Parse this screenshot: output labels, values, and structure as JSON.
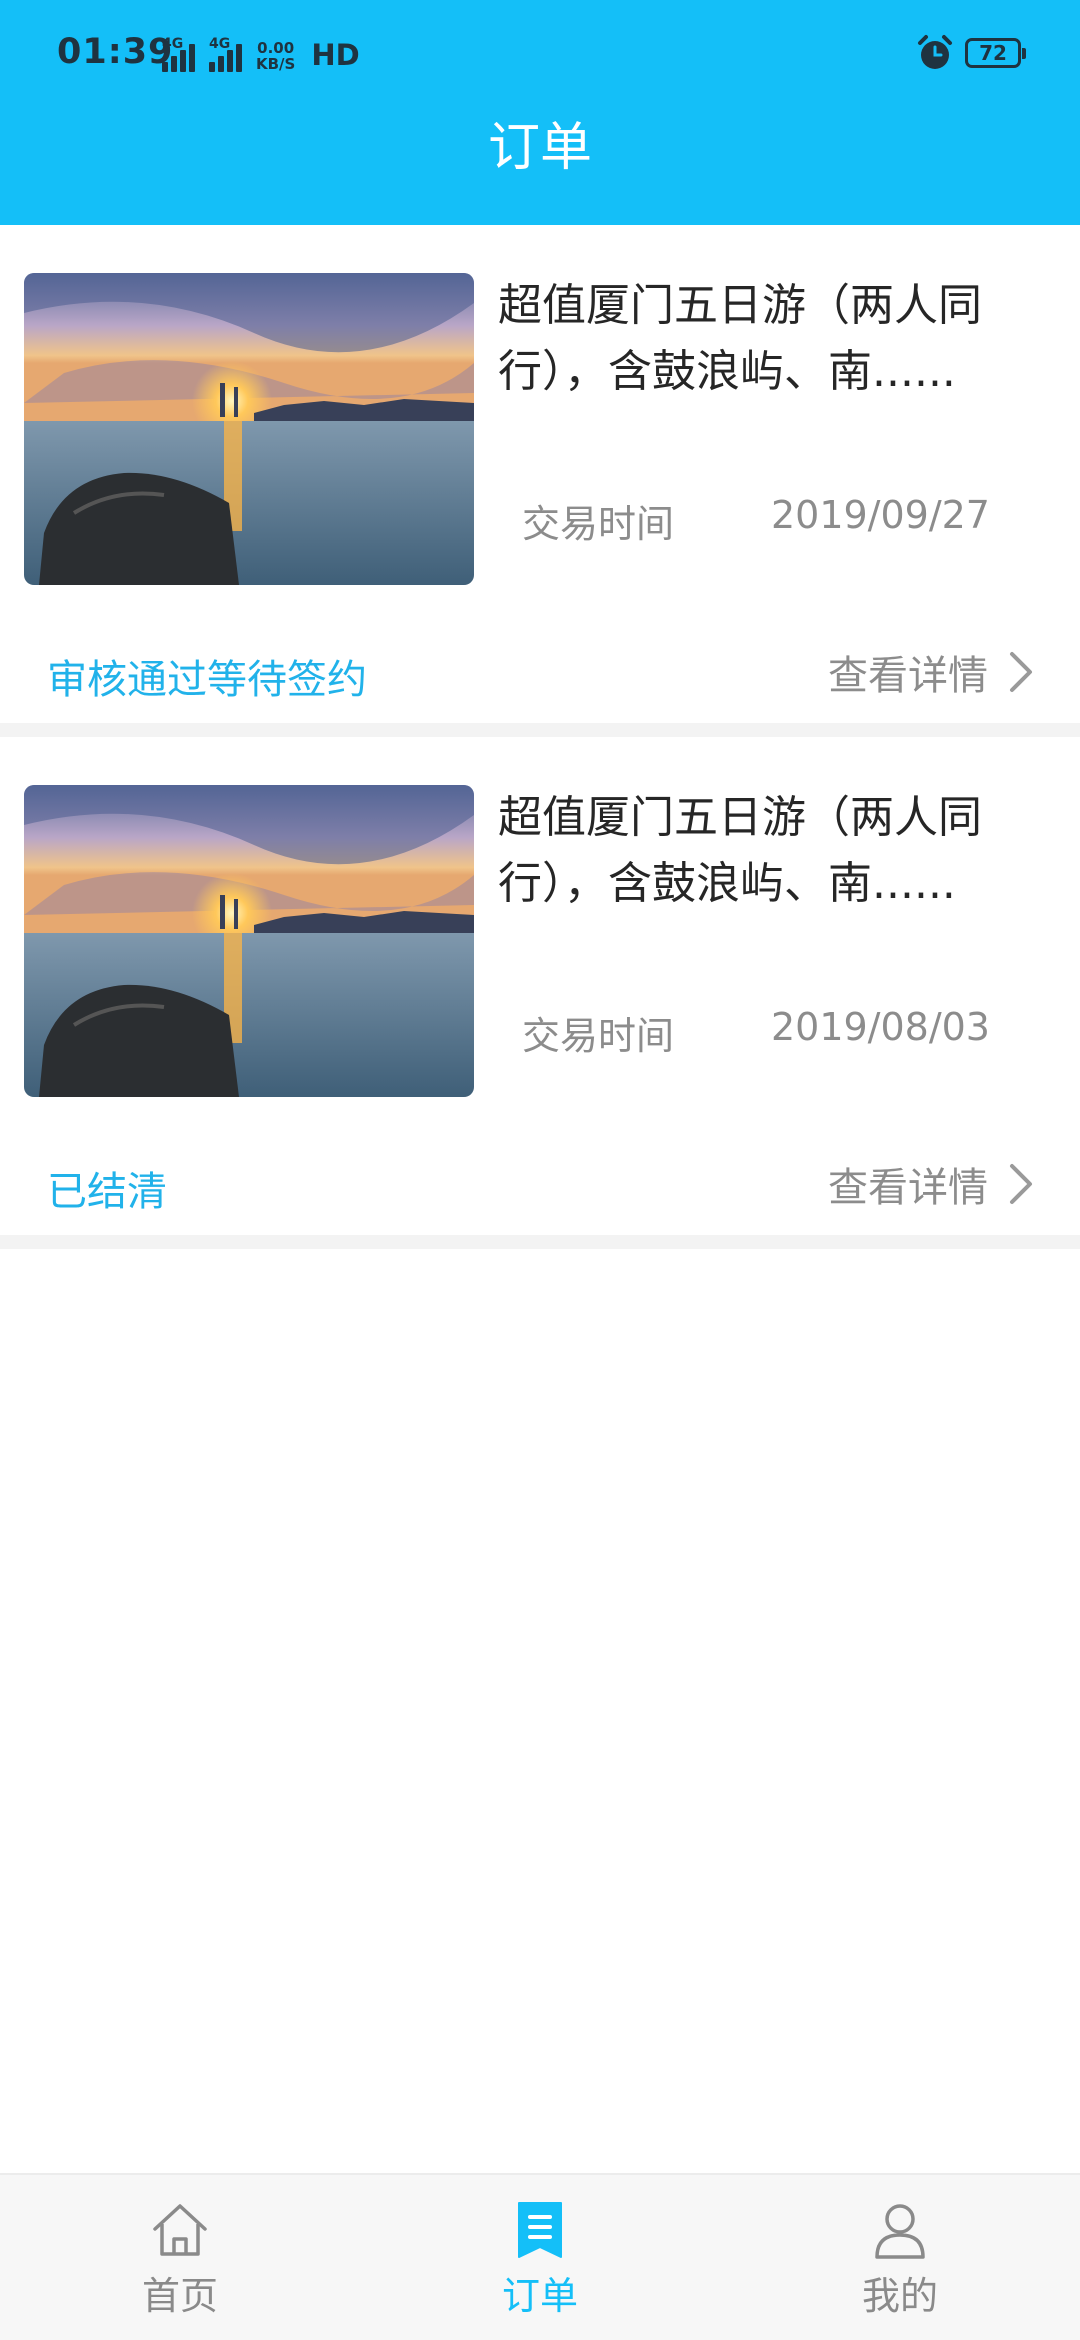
{
  "status_bar": {
    "time": "01:39",
    "signal_1_tag": "4G",
    "signal_2_tag": "4G",
    "net_speed_value": "0.00",
    "net_speed_unit": "KB/S",
    "hd_label": "HD",
    "battery_level": "72"
  },
  "header": {
    "title": "订单"
  },
  "orders": [
    {
      "title": "超值厦门五日游（两人同行），含鼓浪屿、南......",
      "time_label": "交易时间",
      "date": "2019/09/27",
      "status": "审核通过等待签约",
      "detail_label": "查看详情"
    },
    {
      "title": "超值厦门五日游（两人同行），含鼓浪屿、南......",
      "time_label": "交易时间",
      "date": "2019/08/03",
      "status": "已结清",
      "detail_label": "查看详情"
    }
  ],
  "bottom_nav": {
    "items": [
      {
        "label": "首页",
        "icon": "home-icon",
        "active": false
      },
      {
        "label": "订单",
        "icon": "order-icon",
        "active": true
      },
      {
        "label": "我的",
        "icon": "user-icon",
        "active": false
      }
    ]
  },
  "colors": {
    "accent": "#14bff8",
    "status_text": "#21b2ea",
    "secondary_text": "#8c8c8c"
  }
}
